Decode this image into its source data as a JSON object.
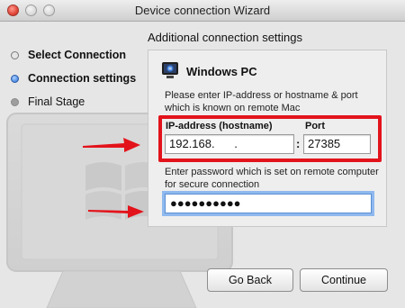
{
  "window": {
    "title": "Device connection Wizard"
  },
  "steps": [
    {
      "label": "Select Connection",
      "state": "done"
    },
    {
      "label": "Connection settings",
      "state": "current"
    },
    {
      "label": "Final Stage",
      "state": "todo"
    }
  ],
  "section": {
    "title": "Additional connection settings"
  },
  "panel": {
    "icon": "windows-pc-icon",
    "title": "Windows PC",
    "description": "Please enter IP-address or hostname & port which is known on remote Mac",
    "ip_label": "IP-address (hostname)",
    "ip_value": "192.168.      .",
    "port_separator": ":",
    "port_label": "Port",
    "port_value": "27385",
    "password_description": "Enter password which is set on remote computer for secure connection",
    "password_value": "●●●●●●●●●●"
  },
  "buttons": {
    "back": "Go Back",
    "continue": "Continue"
  },
  "colors": {
    "highlight": "#e3131b",
    "arrow": "#e3131b",
    "focus_ring": "#8fb9ee",
    "current_step": "#2a6fd6"
  }
}
